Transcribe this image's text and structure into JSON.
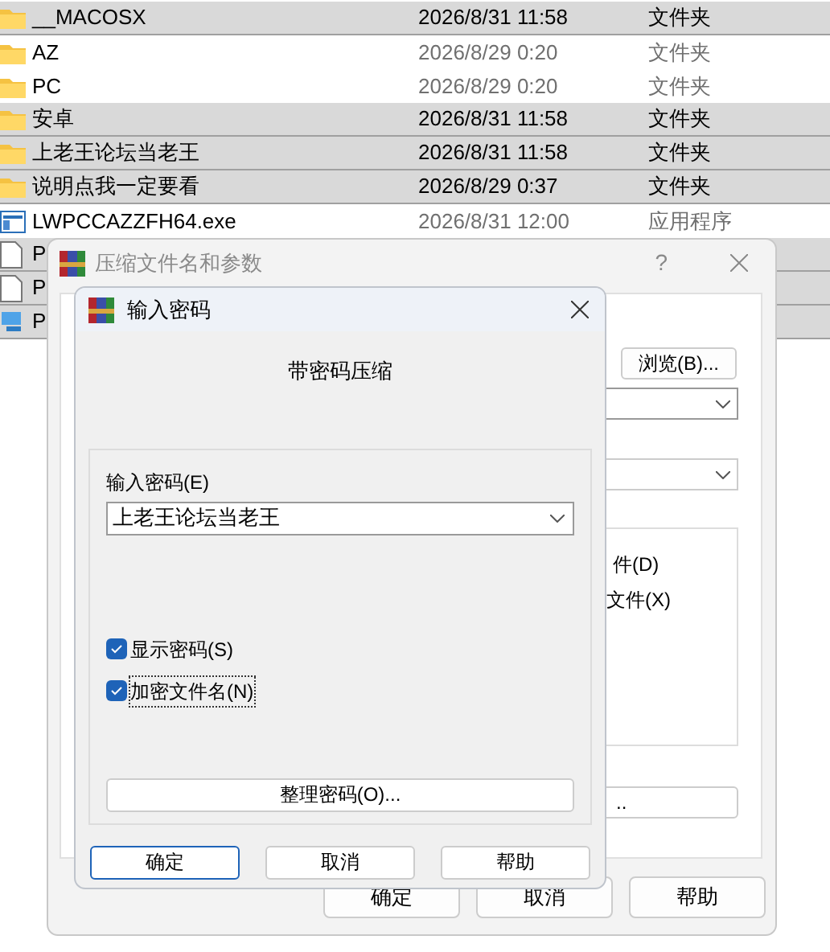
{
  "files": [
    {
      "kind": "folder",
      "name": "__MACOSX",
      "date": "2026/8/31 11:58",
      "type": "文件夹",
      "selected": true
    },
    {
      "kind": "folder",
      "name": "AZ",
      "date": "2026/8/29 0:20",
      "type": "文件夹",
      "selected": false
    },
    {
      "kind": "folder",
      "name": "PC",
      "date": "2026/8/29 0:20",
      "type": "文件夹",
      "selected": false
    },
    {
      "kind": "folder",
      "name": "安卓",
      "date": "2026/8/31 11:58",
      "type": "文件夹",
      "selected": true
    },
    {
      "kind": "folder",
      "name": "上老王论坛当老王",
      "date": "2026/8/31 11:58",
      "type": "文件夹",
      "selected": true
    },
    {
      "kind": "folder",
      "name": "说明点我一定要看",
      "date": "2026/8/29 0:37",
      "type": "文件夹",
      "selected": true
    },
    {
      "kind": "exe",
      "name": "LWPCCAZZFH64.exe",
      "date": "2026/8/31 12:00",
      "type": "应用程序",
      "selected": false
    },
    {
      "kind": "document",
      "name": "P",
      "selected": true
    },
    {
      "kind": "document",
      "name": "P",
      "selected": true
    },
    {
      "kind": "shortcut",
      "name": "P",
      "selected": true
    }
  ],
  "archive_dialog": {
    "title": "压缩文件名和参数",
    "help": "?",
    "browse_button": "浏览(B)...",
    "options": [
      "件(D)",
      "文件(X)"
    ],
    "more_button": "..",
    "buttons": [
      "确定",
      "取消",
      "帮助"
    ]
  },
  "password_dialog": {
    "title": "输入密码",
    "heading": "带密码压缩",
    "field_label": "输入密码(E)",
    "password": "上老王论坛当老王",
    "checkboxes": [
      {
        "label": "显示密码(S)",
        "checked": true,
        "focused": false
      },
      {
        "label": "加密文件名(N)",
        "checked": true,
        "focused": true
      }
    ],
    "organize_button": "整理密码(O)...",
    "buttons": [
      {
        "label": "确定",
        "default": true
      },
      {
        "label": "取消",
        "default": false
      },
      {
        "label": "帮助",
        "default": false
      }
    ]
  }
}
